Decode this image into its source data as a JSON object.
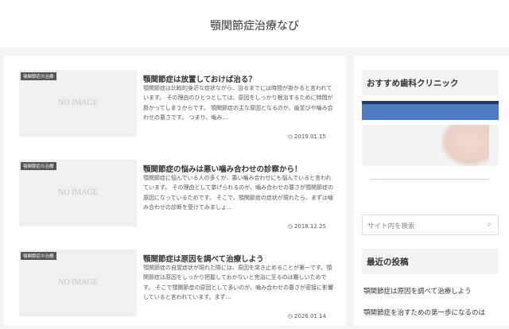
{
  "site": {
    "title": "顎関節症治療なび"
  },
  "posts": [
    {
      "category": "顎関節症の治療",
      "thumb": "NO IMAGE",
      "title": "顎関節症は放置しておけば治る？",
      "excerpt": "顎関節症は比較的身近な症状ながら、治るまでには時間が掛かると言われています。 その理由のひとつとしては、原因をしっかり根治するために時間が掛かってしまうからです。 顎関節症の主な原因となるのが、歯並びや噛み合わせの悪さです。 つまり、噛み…",
      "date": "2019.01.15"
    },
    {
      "category": "顎関節症の治療",
      "thumb": "NO IMAGE",
      "title": "顎関節症の悩みは悪い噛み合わせの診察から！",
      "excerpt": "顎関節症に悩んでいる人の多くが、悪い噛み合わせにも悩んでいると言われています。 その理由として挙げられるのが、噛み合わせの悪さが顎関節症の原因になっているためです。 そこで、顎関節症の症状が現れたら、まずは噛み合わせの診断を受けてみましょ…",
      "date": "2018.12.25"
    },
    {
      "category": "顎関節症の治療",
      "thumb": "NO IMAGE",
      "title": "顎関節症は原因を調べて治療しよう",
      "excerpt": "顎関節症の自覚症状が現れた際には、原因を突き止めることが第一です。顎関節症は原因をしっかり把握しておかないと完治に至るのは難しいためです。 そこで顎関節症の原因として多いのが、噛み合わせの悪さが密接に影響していると言われています。まず…",
      "date": "2026.01.14"
    }
  ],
  "sidebar": {
    "clinic_heading": "おすすめ歯科クリニック",
    "search_placeholder": "サイト内を検索",
    "recent_heading": "最近の投稿",
    "recent": [
      "顎関節症は原因を調べて治療しよう",
      "顎関節症を治すための第一歩になるのは"
    ]
  }
}
